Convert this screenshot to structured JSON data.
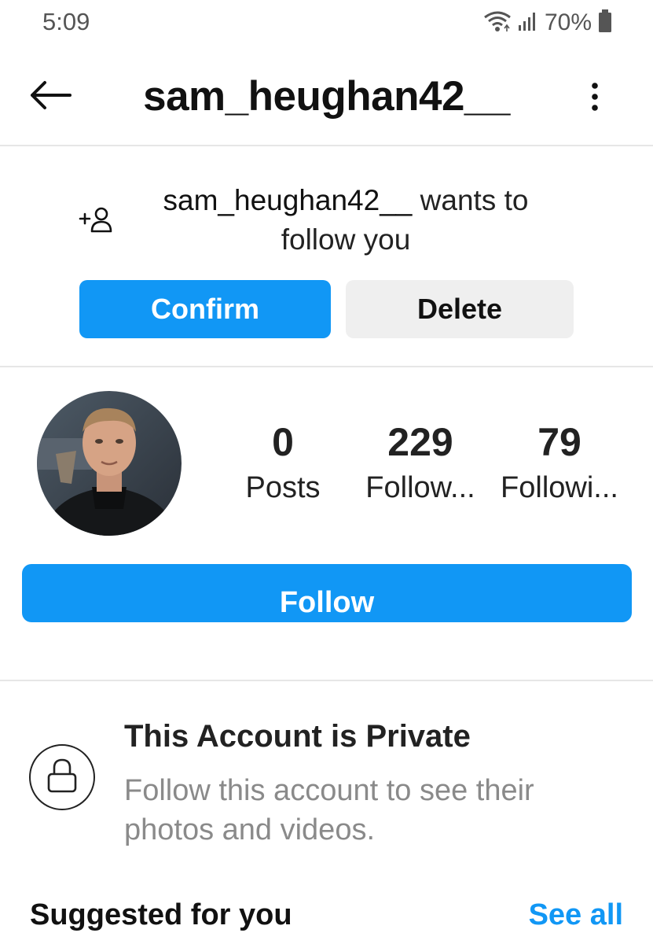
{
  "status_bar": {
    "time": "5:09",
    "battery": "70%",
    "icons": [
      "wifi-icon",
      "signal-icon",
      "battery-icon"
    ]
  },
  "header": {
    "title": "sam_heughan42__",
    "back_icon": "back-arrow-icon",
    "more_icon": "more-vertical-icon"
  },
  "follow_request": {
    "icon": "add-person-icon",
    "username": "sam_heughan42__",
    "message": " wants to follow you",
    "confirm_label": "Confirm",
    "delete_label": "Delete"
  },
  "profile": {
    "avatar_icon": "profile-photo",
    "stats": {
      "posts_value": "0",
      "posts_label": "Posts",
      "followers_value": "229",
      "followers_label": "Follow...",
      "following_value": "79",
      "following_label": "Followi..."
    },
    "follow_label": "Follow"
  },
  "private_account": {
    "icon": "lock-icon",
    "title": "This Account is Private",
    "description": "Follow this account to see their photos and videos."
  },
  "suggested": {
    "title": "Suggested for you",
    "see_all_label": "See all"
  },
  "colors": {
    "primary_blue": "#1197f5",
    "secondary_button": "#efefef",
    "muted_text": "#8a8a8a"
  }
}
